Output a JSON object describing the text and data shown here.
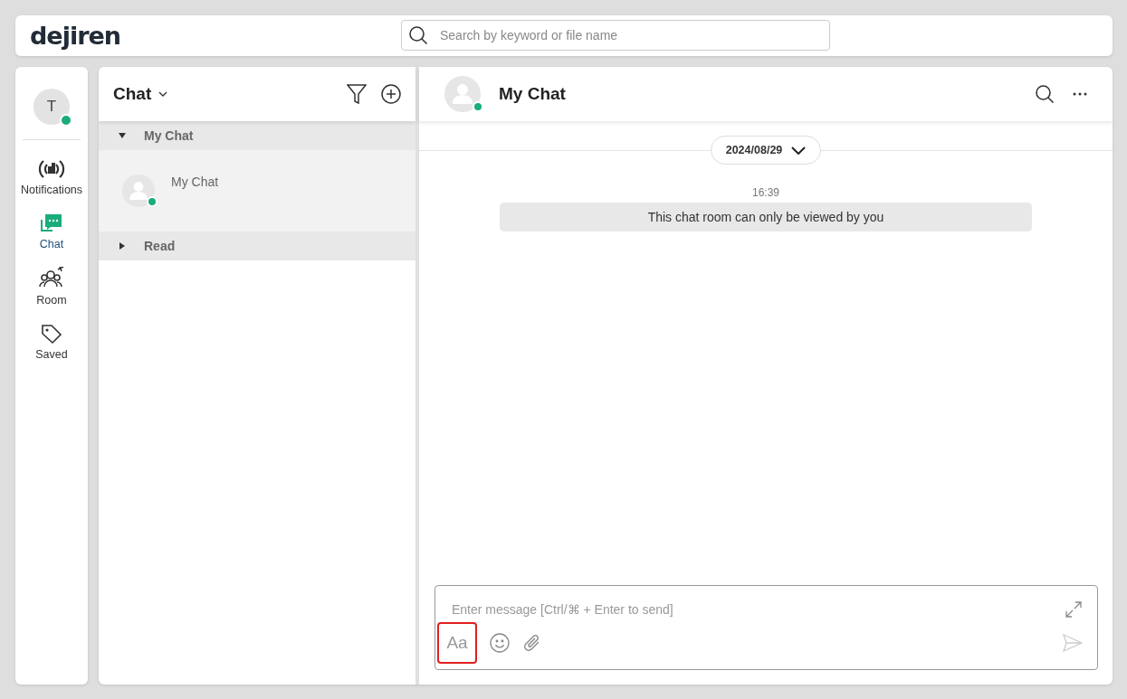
{
  "header": {
    "logo": "dejiren",
    "search": {
      "placeholder": "Search by keyword or file name"
    }
  },
  "user": {
    "initial": "T",
    "online": true
  },
  "nav": [
    {
      "label": "Notifications",
      "selected": false
    },
    {
      "label": "Chat",
      "selected": true
    },
    {
      "label": "Room",
      "selected": false
    },
    {
      "label": "Saved",
      "selected": false
    }
  ],
  "chat_list": {
    "title": "Chat",
    "groups": [
      {
        "label": "My Chat",
        "expanded": true,
        "children": [
          {
            "name": "My Chat",
            "online": true,
            "selected": true
          }
        ]
      },
      {
        "label": "Read",
        "expanded": false
      }
    ]
  },
  "room": {
    "title": "My Chat",
    "online": true,
    "date": "2024/08/29",
    "messages": [
      {
        "kind": "system",
        "time": "16:39",
        "text": "This chat room can only be viewed by you"
      }
    ]
  },
  "composer": {
    "placeholder": "Enter message [Ctrl/⌘ + Enter to send]",
    "format_button": "Aa",
    "format_highlighted": true
  }
}
